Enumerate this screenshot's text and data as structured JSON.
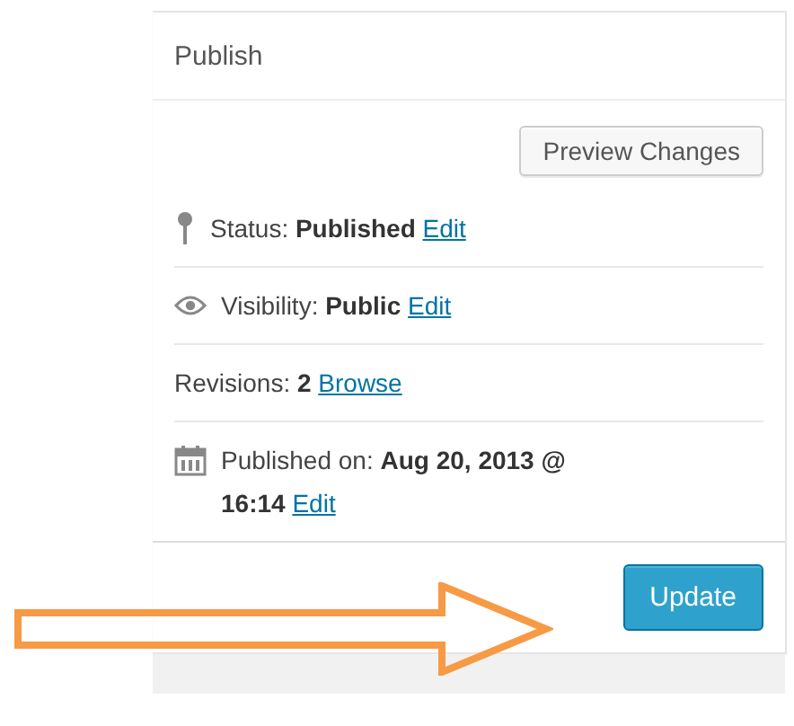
{
  "panel": {
    "title": "Publish",
    "preview_button": "Preview Changes",
    "rows": [
      {
        "kind": "status",
        "text": "Status: **Published**",
        "link": "Edit"
      },
      {
        "kind": "visibility",
        "text": "Visibility: **Public**",
        "link": "Edit"
      },
      {
        "kind": "revisions",
        "text": "Revisions: **2**",
        "link": "Browse"
      },
      {
        "kind": "date",
        "text": "Published on: **Aug 20, 2013 @ 16:14**",
        "link": "Edit"
      }
    ],
    "update_button": "Update"
  }
}
